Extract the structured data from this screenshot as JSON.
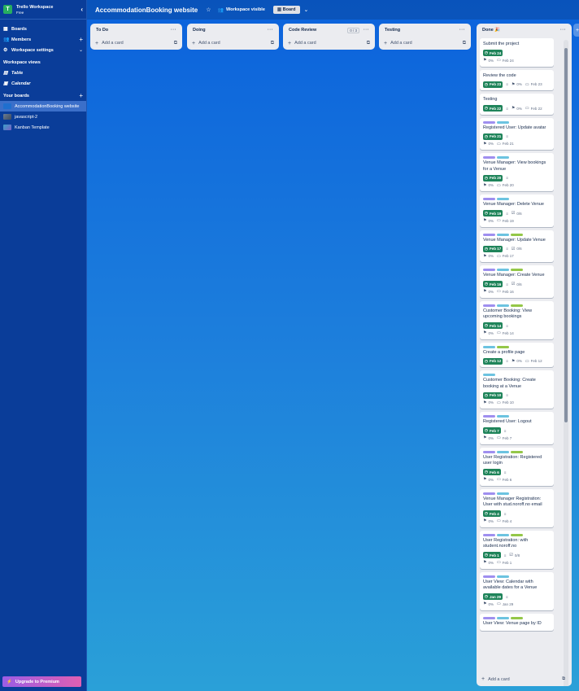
{
  "sidebar": {
    "workspace_name": "Trello Workspace",
    "workspace_plan": "Free",
    "logo_letter": "T",
    "nav": [
      {
        "label": "Boards",
        "icon": "board-icon"
      },
      {
        "label": "Members",
        "icon": "members-icon"
      },
      {
        "label": "Workspace settings",
        "icon": "gear-icon"
      }
    ],
    "views_heading": "Workspace views",
    "views": [
      {
        "label": "Table",
        "icon": "table-icon"
      },
      {
        "label": "Calendar",
        "icon": "calendar-icon"
      }
    ],
    "boards_heading": "Your boards",
    "boards": [
      {
        "label": "AccommodationBooking website",
        "color": "#1f6fcf"
      },
      {
        "label": "javascript-2",
        "color": "#5a6b80"
      },
      {
        "label": "Kanban Template",
        "color": "#3aa0c9"
      }
    ],
    "upgrade": "Upgrade to Premium"
  },
  "topbar": {
    "title": "AccommodationBooking website",
    "visibility": "Workspace visible",
    "view": "Board"
  },
  "lists": [
    {
      "title": "To Do",
      "add": "Add a card"
    },
    {
      "title": "Doing",
      "add": "Add a card"
    },
    {
      "title": "Code Review",
      "count": "0 / 3",
      "add": "Add a card"
    },
    {
      "title": "Testing",
      "add": "Add a card"
    }
  ],
  "done": {
    "title": "Done 🎉",
    "add": "Add a card",
    "cards": [
      {
        "labels": [],
        "title": "Submit the project",
        "due": "Feb 24",
        "desc": false,
        "pct": "0%",
        "date": "Feb 24"
      },
      {
        "labels": [],
        "title": "Review the code",
        "due": "Feb 23",
        "desc": true,
        "pct": "0%",
        "date": "Feb 23",
        "inline": true
      },
      {
        "labels": [],
        "title": "Testing",
        "due": "Feb 22",
        "desc": true,
        "pct": "0%",
        "date": "Feb 22",
        "inline": true
      },
      {
        "labels": [
          "purple",
          "blue"
        ],
        "title": "Registered User: Update avatar",
        "due": "Feb 21",
        "desc": true,
        "pct": "0%",
        "date": "Feb 21"
      },
      {
        "labels": [
          "purple",
          "blue"
        ],
        "title": "Venue Manager: View bookings for a Venue",
        "due": "Feb 20",
        "desc": true,
        "pct": "0%",
        "date": "Feb 20"
      },
      {
        "labels": [
          "purple",
          "blue"
        ],
        "title": "Venue Manager: Delete Venue",
        "due": "Feb 19",
        "desc": true,
        "check": "0/6",
        "pct": "0%",
        "date": "Feb 19"
      },
      {
        "labels": [
          "purple",
          "blue",
          "green"
        ],
        "title": "Venue Manager: Update Venue",
        "due": "Feb 17",
        "desc": true,
        "check": "0/6",
        "pct": "0%",
        "date": "Feb 17"
      },
      {
        "labels": [
          "purple",
          "blue",
          "green"
        ],
        "title": "Venue Manager: Create Venue",
        "due": "Feb 16",
        "desc": true,
        "check": "0/6",
        "pct": "0%",
        "date": "Feb 16"
      },
      {
        "labels": [
          "purple",
          "blue",
          "green"
        ],
        "title": "Customer Booking: View upcoming bookings",
        "due": "Feb 14",
        "desc": true,
        "pct": "0%",
        "date": "Feb 14"
      },
      {
        "labels": [
          "blue",
          "green"
        ],
        "title": "Create a profile page",
        "due": "Feb 12",
        "desc": true,
        "pct": "0%",
        "date": "Feb 12",
        "inline": true
      },
      {
        "labels": [
          "blue"
        ],
        "title": "Customer Booking: Create booking at a Venue",
        "due": "Feb 10",
        "desc": true,
        "pct": "0%",
        "date": "Feb 10"
      },
      {
        "labels": [
          "purple",
          "blue"
        ],
        "title": "Registered User: Logout",
        "due": "Feb 7",
        "desc": true,
        "pct": "0%",
        "date": "Feb 7"
      },
      {
        "labels": [
          "purple",
          "blue",
          "green"
        ],
        "title": "User Registration: Registered user login",
        "due": "Feb 6",
        "desc": true,
        "pct": "0%",
        "date": "Feb 6"
      },
      {
        "labels": [
          "purple",
          "blue"
        ],
        "title": "Venue Manager Registration: User with stud.noroff.no email",
        "due": "Feb 4",
        "desc": true,
        "pct": "0%",
        "date": "Feb 4"
      },
      {
        "labels": [
          "purple",
          "blue",
          "green"
        ],
        "title": "User Registration: with student.noroff.no",
        "due": "Feb 1",
        "desc": true,
        "check": "0/8",
        "pct": "0%",
        "date": "Feb 1"
      },
      {
        "labels": [
          "purple",
          "blue"
        ],
        "title": "User View: Calendar with available dates for a Venue",
        "due": "Jan 29",
        "desc": true,
        "pct": "0%",
        "date": "Jan 29"
      },
      {
        "labels": [
          "purple",
          "blue",
          "green"
        ],
        "title": "User View: Venue page by ID",
        "due": "",
        "desc": false,
        "pct": "",
        "date": ""
      }
    ]
  }
}
